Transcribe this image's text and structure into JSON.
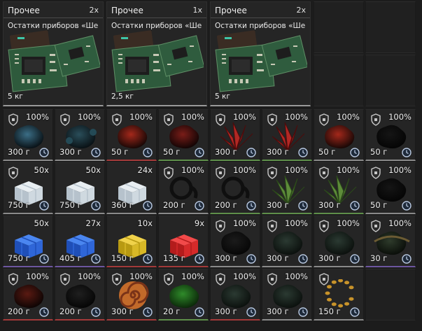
{
  "big_items": [
    {
      "category": "Прочее",
      "count": "2x",
      "name": "Остатки приборов «Ше...",
      "weight": "5 кг"
    },
    {
      "category": "Прочее",
      "count": "1x",
      "name": "Остатки приборов «Ше...",
      "weight": "2,5 кг"
    },
    {
      "category": "Прочее",
      "count": "2x",
      "name": "Остатки приборов «Ше...",
      "weight": "5 кг"
    }
  ],
  "icons": {
    "durability": "shield-icon",
    "expiry": "clock-icon"
  },
  "colors": {
    "rarity_green": "#5e8f4a",
    "rarity_red": "#a33a3a",
    "rarity_purple": "#6d56a0",
    "rarity_grey": "#8a8a8a"
  },
  "rows": [
    [
      {
        "badge": "100%",
        "weight": "300 г",
        "shield": true,
        "item": "blue-dark-organic",
        "rarity": "grey"
      },
      {
        "badge": "100%",
        "weight": "300 г",
        "shield": true,
        "item": "blue-dark-beads",
        "rarity": "grey"
      },
      {
        "badge": "100%",
        "weight": "50 г",
        "shield": true,
        "item": "red-dark-organic",
        "rarity": "red"
      },
      {
        "badge": "100%",
        "weight": "50 г",
        "shield": true,
        "item": "red-dark-claw",
        "rarity": "green"
      },
      {
        "badge": "100%",
        "weight": "300 г",
        "shield": true,
        "item": "red-crystal",
        "rarity": "green"
      },
      {
        "badge": "100%",
        "weight": "300 г",
        "shield": true,
        "item": "red-crystal",
        "rarity": "green"
      },
      {
        "badge": "100%",
        "weight": "50 г",
        "shield": true,
        "item": "red-dark-organic",
        "rarity": "grey"
      },
      {
        "badge": "100%",
        "weight": "50 г",
        "shield": true,
        "item": "black-organic",
        "rarity": "grey"
      }
    ],
    [
      {
        "badge": "50x",
        "weight": "750 г",
        "shield": true,
        "item": "white-cube",
        "rarity": "grey"
      },
      {
        "badge": "50x",
        "weight": "750 г",
        "shield": false,
        "item": "white-cube",
        "rarity": "grey"
      },
      {
        "badge": "24x",
        "weight": "360 г",
        "shield": false,
        "item": "white-cube",
        "rarity": "grey"
      },
      {
        "badge": "100%",
        "weight": "200 г",
        "shield": true,
        "item": "black-ring",
        "rarity": "grey"
      },
      {
        "badge": "100%",
        "weight": "200 г",
        "shield": true,
        "item": "black-ring",
        "rarity": "green"
      },
      {
        "badge": "100%",
        "weight": "300 г",
        "shield": true,
        "item": "green-crystal",
        "rarity": "green"
      },
      {
        "badge": "100%",
        "weight": "300 г",
        "shield": true,
        "item": "green-crystal",
        "rarity": "green"
      },
      {
        "badge": "100%",
        "weight": "50 г",
        "shield": true,
        "item": "black-organic",
        "rarity": "grey"
      }
    ],
    [
      {
        "badge": "50x",
        "weight": "750 г",
        "shield": false,
        "item": "blue-cube",
        "rarity": "purple"
      },
      {
        "badge": "27x",
        "weight": "405 г",
        "shield": false,
        "item": "blue-cube",
        "rarity": "purple"
      },
      {
        "badge": "10x",
        "weight": "150 г",
        "shield": false,
        "item": "yellow-cube",
        "rarity": "red"
      },
      {
        "badge": "9x",
        "weight": "135 г",
        "shield": false,
        "item": "red-cube",
        "rarity": "red"
      },
      {
        "badge": "100%",
        "weight": "300 г",
        "shield": true,
        "item": "black-rock",
        "rarity": "grey"
      },
      {
        "badge": "100%",
        "weight": "300 г",
        "shield": true,
        "item": "dark-green-rock",
        "rarity": "grey"
      },
      {
        "badge": "100%",
        "weight": "300 г",
        "shield": true,
        "item": "dark-green-rock",
        "rarity": "grey"
      },
      {
        "badge": "100%",
        "weight": "30 г",
        "shield": true,
        "item": "dark-moss",
        "rarity": "purple"
      }
    ],
    [
      {
        "badge": "100%",
        "weight": "200 г",
        "shield": true,
        "item": "red-black-organic",
        "rarity": "red"
      },
      {
        "badge": "100%",
        "weight": "200 г",
        "shield": true,
        "item": "black-organic-small",
        "rarity": "red"
      },
      {
        "badge": "100%",
        "weight": "300 г",
        "shield": true,
        "item": "orange-spiral",
        "rarity": "red"
      },
      {
        "badge": "100%",
        "weight": "20 г",
        "shield": true,
        "item": "green-rock",
        "rarity": "green"
      },
      {
        "badge": "100%",
        "weight": "300 г",
        "shield": true,
        "item": "dark-green-rock",
        "rarity": "red"
      },
      {
        "badge": "100%",
        "weight": "300 г",
        "shield": true,
        "item": "dark-green-rock",
        "rarity": "grey"
      },
      {
        "badge": "",
        "weight": "150 г",
        "shield": true,
        "item": "amber-necklace",
        "rarity": "grey"
      },
      null
    ]
  ]
}
